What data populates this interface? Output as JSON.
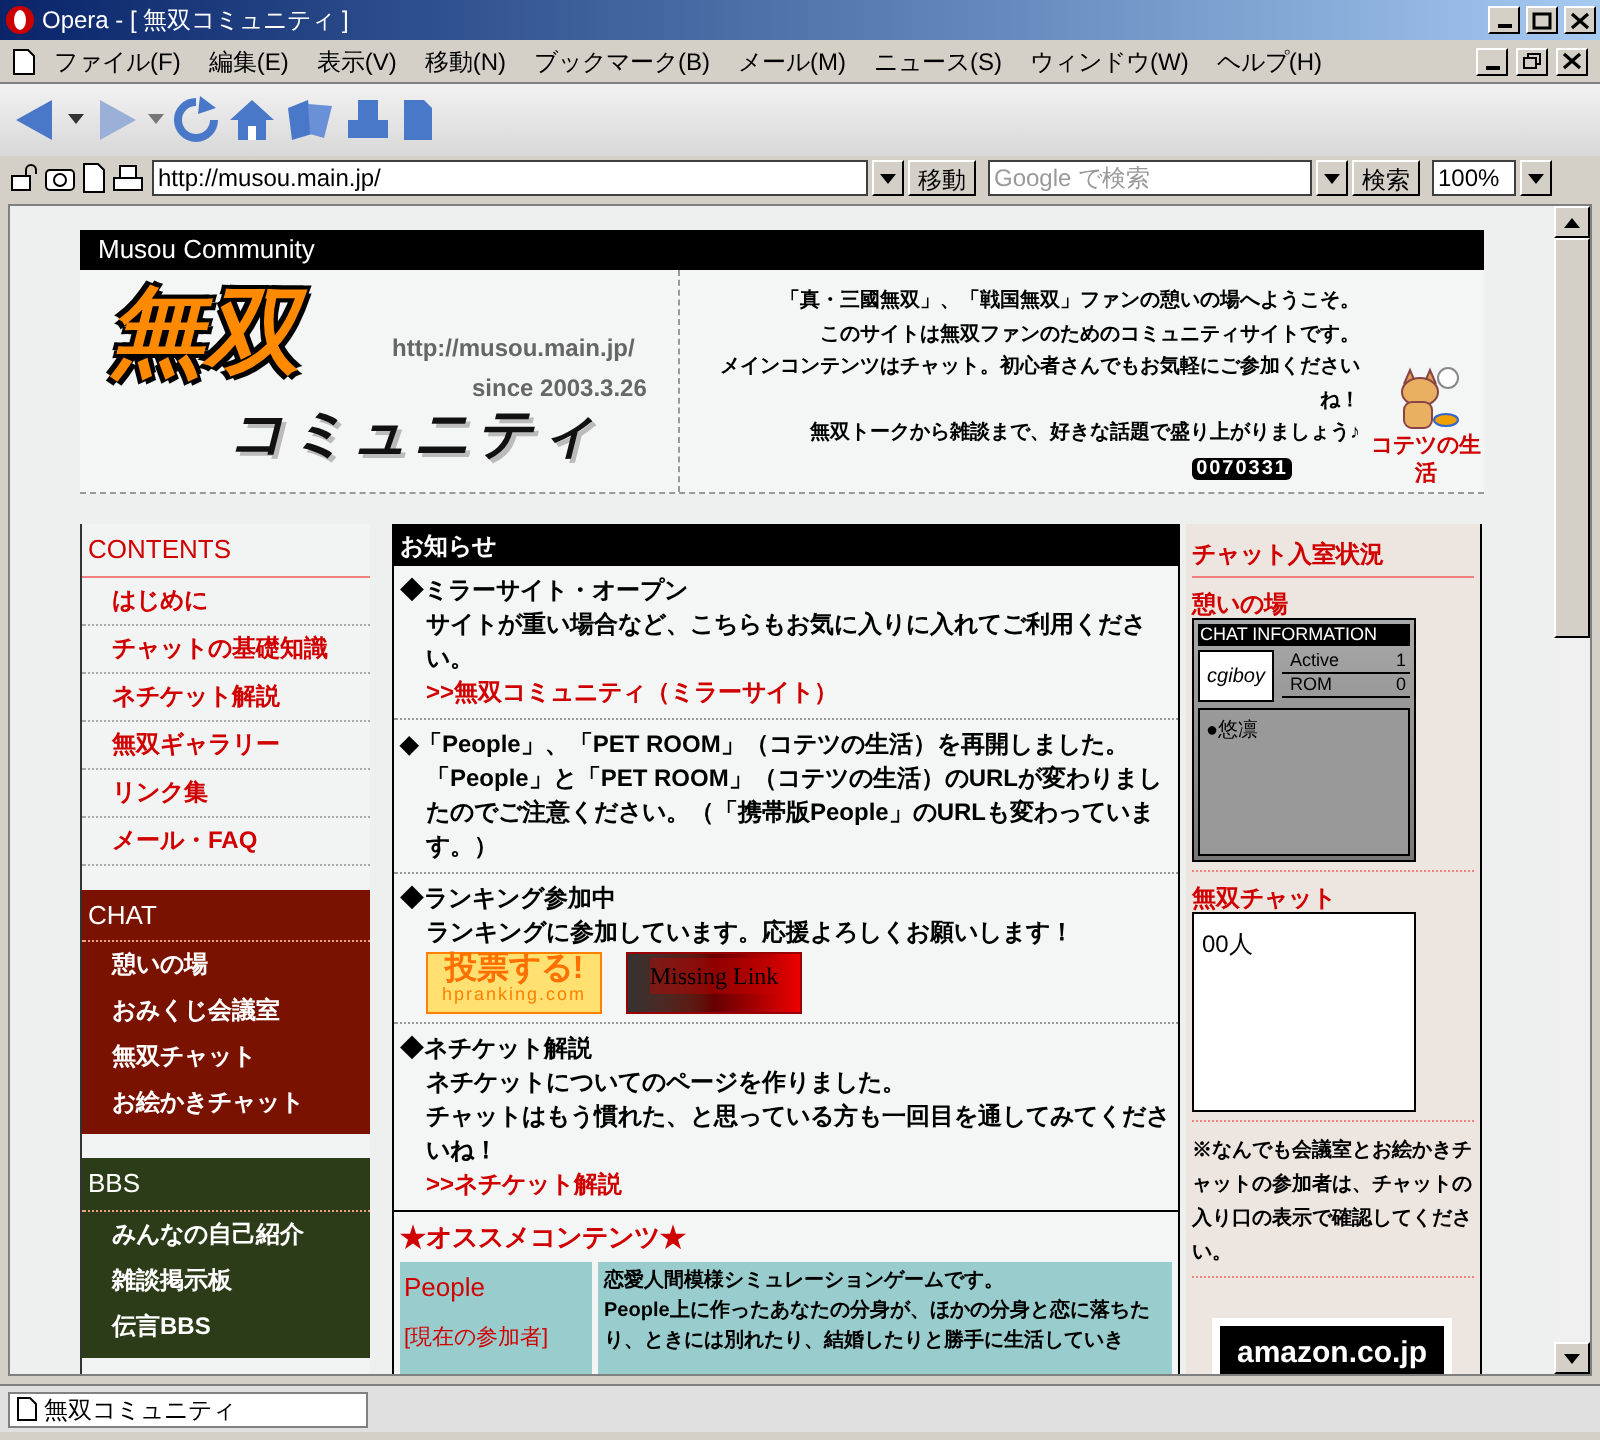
{
  "window": {
    "title": "Opera - [ 無双コミュニティ ]"
  },
  "menu": [
    "ファイル(F)",
    "編集(E)",
    "表示(V)",
    "移動(N)",
    "ブックマーク(B)",
    "メール(M)",
    "ニュース(S)",
    "ウィンドウ(W)",
    "ヘルプ(H)"
  ],
  "address_bar": {
    "url": "http://musou.main.jp/",
    "go_button": "移動",
    "search_placeholder": "Google で検索",
    "search_button": "検索",
    "zoom": "100%"
  },
  "page": {
    "header_title": "Musou Community",
    "logo": {
      "title": "無双",
      "subtitle": "コミュニティ",
      "url": "http://musou.main.jp/",
      "since": "since 2003.3.26"
    },
    "welcome": [
      "「真・三國無双」、「戦国無双」ファンの憩いの場へようこそ。",
      "このサイトは無双ファンのためのコミュニティサイトです。",
      "メインコンテンツはチャット。初心者さんでもお気軽にご参加ください",
      "ね！",
      "無双トークから雑談まで、好きな話題で盛り上がりましょう♪"
    ],
    "counter": "0070331",
    "pet_link": "コテツの生活",
    "sidebar_sections": [
      {
        "kind": "contents",
        "title": "CONTENTS",
        "items": [
          "はじめに",
          "チャットの基礎知識",
          "ネチケット解説",
          "無双ギャラリー",
          "リンク集",
          "メール・FAQ"
        ]
      },
      {
        "kind": "chat",
        "title": "CHAT",
        "items": [
          "憩いの場",
          "おみくじ会議室",
          "無双チャット",
          "お絵かきチャット"
        ]
      },
      {
        "kind": "bbs",
        "title": "BBS",
        "items": [
          "みんなの自己紹介",
          "雑談掲示板",
          "伝言BBS"
        ]
      }
    ],
    "news": {
      "title": "お知らせ",
      "items": [
        {
          "heading": "◆ミラーサイト・オープン",
          "body": [
            "サイトが重い場合など、こちらもお気に入りに入れてご利用ください。"
          ],
          "link": ">>無双コミュニティ（ミラーサイト）"
        },
        {
          "heading": "◆「People」、「PET ROOM」（コテツの生活）を再開しました。",
          "body": [
            "「People」と「PET ROOM」（コテツの生活）のURLが変わりましたのでご注意ください。（「携帯版People」のURLも変わっています。）"
          ]
        },
        {
          "heading": "◆ランキング参加中",
          "body": [
            "ランキングに参加しています。応援よろしくお願いします！"
          ],
          "banners": [
            {
              "kind": "vote",
              "text": "投票する!",
              "sub": "hpranking.com"
            },
            {
              "kind": "link",
              "text": "Missing Link"
            }
          ]
        },
        {
          "heading": "◆ネチケット解説",
          "body": [
            "ネチケットについてのページを作りました。",
            "チャットはもう慣れた、と思っている方も一回目を通してみてくださいね！"
          ],
          "link": ">>ネチケット解説"
        }
      ]
    },
    "recommend": {
      "title": "★オススメコンテンツ★",
      "rows": [
        {
          "name": "People",
          "note": "[現在の参加者]",
          "description": [
            "恋愛人間模様シミュレーションゲームです。",
            "People上に作ったあなたの分身が、ほかの分身と恋に落ちたり、ときには別れたり、結婚したりと勝手に生活していき"
          ]
        }
      ]
    },
    "chat_status": {
      "title": "チャット入室状況",
      "rooms": [
        {
          "kind": "widget",
          "name": "憩いの場",
          "widget_title": "CHAT INFORMATION",
          "logo": "cgiboy",
          "stats": [
            {
              "label": "Active",
              "value": "1"
            },
            {
              "label": "ROM",
              "value": "0"
            }
          ],
          "members": [
            "●悠凛"
          ]
        },
        {
          "kind": "count",
          "name": "無双チャット",
          "count": "00人"
        }
      ],
      "note": "※なんでも会議室とお絵かきチャットの参加者は、チャットの入り口の表示で確認してください。",
      "ad": "amazon.co.jp"
    }
  },
  "status_bar": {
    "text": "無双コミュニティ"
  }
}
